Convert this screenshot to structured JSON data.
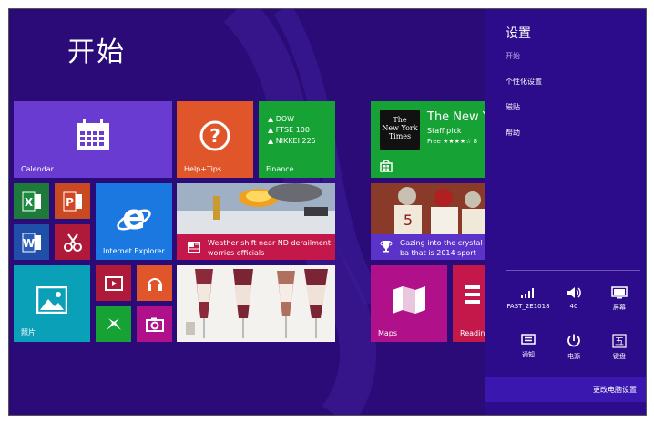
{
  "start": {
    "title": "开始"
  },
  "tiles": {
    "calendar": "Calendar",
    "help": "Help+Tips",
    "finance": {
      "label": "Finance",
      "lines": [
        "▲ DOW",
        "▲ FTSE 100",
        "▲ NIKKEI 225"
      ]
    },
    "ie": "Internet Explorer",
    "news": {
      "caption": "Weather shift near ND derailment worries officials"
    },
    "nyt": {
      "title": "The New Y",
      "staff": "Staff pick",
      "free": "Free ★★★★☆ 8"
    },
    "sports": {
      "caption": "Gazing into the crystal ba that is 2014 sport"
    },
    "photos": "照片",
    "maps": "Maps",
    "reading": "Reading"
  },
  "charm": {
    "title": "设置",
    "subtitle": "开始",
    "links": [
      "个性化设置",
      "磁贴",
      "帮助"
    ],
    "quick": [
      {
        "label": "FAST_2E1018",
        "icon": "wifi-icon"
      },
      {
        "label": "40",
        "icon": "volume-icon"
      },
      {
        "label": "屏幕",
        "icon": "screen-icon"
      },
      {
        "label": "通知",
        "icon": "notifications-icon"
      },
      {
        "label": "电源",
        "icon": "power-icon"
      },
      {
        "label": "键盘",
        "icon": "keyboard-icon"
      }
    ],
    "change_pc_settings": "更改电脑设置"
  },
  "colors": {
    "background": "#2a0b78",
    "calendar": "#6a3bd0",
    "help": "#e0562a",
    "finance": "#17a235",
    "ie": "#1b78e0",
    "photos": "#0aa0b8",
    "maps": "#b0108a",
    "charm": "#2d0c8c"
  }
}
